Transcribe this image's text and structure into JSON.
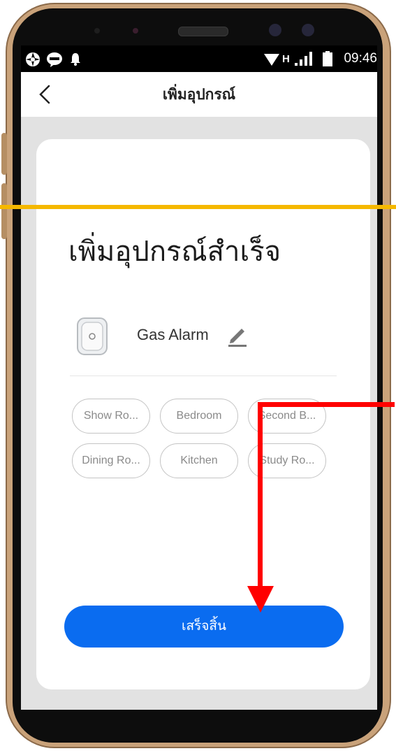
{
  "status_bar": {
    "time": "09:46",
    "network": "H"
  },
  "header": {
    "title": "เพิ่มอุปกรณ์"
  },
  "main": {
    "success_message": "เพิ่มอุปกรณ์สำเร็จ",
    "device_name": "Gas Alarm",
    "rooms": [
      "Show Ro...",
      "Bedroom",
      "Second B...",
      "Dining Ro...",
      "Kitchen",
      "Study Ro..."
    ],
    "done_label": "เสร็จสิ้น"
  },
  "colors": {
    "primary": "#0a6cf0",
    "annotation_line": "#f5b800",
    "annotation_arrow": "#ff0000",
    "phone_frame": "#c9a27a"
  }
}
